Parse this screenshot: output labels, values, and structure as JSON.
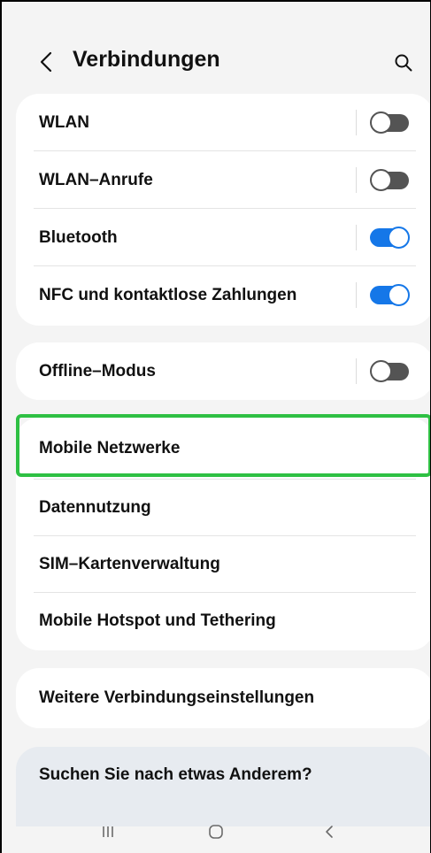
{
  "header": {
    "title": "Verbindungen",
    "back_icon": "chevron-left-icon",
    "search_icon": "search-icon"
  },
  "groups": [
    {
      "items": [
        {
          "label": "WLAN",
          "toggle": "off"
        },
        {
          "label": "WLAN–Anrufe",
          "toggle": "off"
        },
        {
          "label": "Bluetooth",
          "toggle": "on"
        },
        {
          "label": "NFC und kontaktlose Zahlungen",
          "toggle": "on"
        }
      ]
    },
    {
      "items": [
        {
          "label": "Offline–Modus",
          "toggle": "off"
        }
      ]
    },
    {
      "items": [
        {
          "label": "Mobile Netzwerke",
          "highlighted": true
        },
        {
          "label": "Datennutzung"
        },
        {
          "label": "SIM–Kartenverwaltung"
        },
        {
          "label": "Mobile Hotspot und Tethering"
        }
      ]
    },
    {
      "items": [
        {
          "label": "Weitere Verbindungseinstellungen"
        }
      ]
    }
  ],
  "help_card": {
    "label": "Suchen Sie nach etwas Anderem?"
  },
  "navbar": {
    "recents_icon": "recent-apps-icon",
    "home_icon": "home-icon",
    "back_icon": "back-icon"
  },
  "colors": {
    "toggle_on": "#1577e8",
    "toggle_off": "#545454",
    "highlight": "#2ec043",
    "background": "#f4f4f4"
  }
}
